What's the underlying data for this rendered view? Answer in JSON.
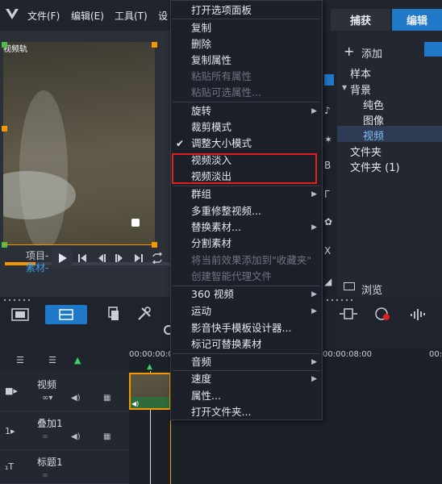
{
  "menubar": {
    "items": [
      "文件(F)",
      "编辑(E)",
      "工具(T)",
      "设"
    ],
    "tabs": [
      "捕获",
      "编辑"
    ]
  },
  "preview": {
    "label": "视频轨",
    "project_label": "项目-",
    "clip_label": "素材-"
  },
  "library": {
    "add_label": "添加",
    "tree": [
      "样本",
      "背景",
      "纯色",
      "图像",
      "视频",
      "文件夹",
      "文件夹 (1)"
    ],
    "browse_label": "浏览"
  },
  "timeline": {
    "ruler": [
      "00:00:00:00",
      "00:00:08:00",
      "00:"
    ],
    "tracks": [
      {
        "name": "视频"
      },
      {
        "name": "叠加1"
      },
      {
        "name": "标题1"
      }
    ]
  },
  "context_menu": {
    "items": [
      {
        "label": "打开选项面板",
        "disabled": false
      },
      {
        "label": "复制",
        "disabled": false
      },
      {
        "label": "删除",
        "disabled": false
      },
      {
        "label": "复制属性",
        "disabled": false
      },
      {
        "label": "粘贴所有属性",
        "disabled": true
      },
      {
        "label": "粘贴可选属性...",
        "disabled": true
      },
      {
        "label": "旋转",
        "disabled": false
      },
      {
        "label": "裁剪模式",
        "disabled": false
      },
      {
        "label": "调整大小模式",
        "disabled": false,
        "checked": true
      },
      {
        "label": "视频淡入",
        "disabled": false
      },
      {
        "label": "视频淡出",
        "disabled": false
      },
      {
        "label": "群组",
        "disabled": false
      },
      {
        "label": "多重修整视频...",
        "disabled": false
      },
      {
        "label": "替换素材...",
        "disabled": false
      },
      {
        "label": "分割素材",
        "disabled": false
      },
      {
        "label": "将当前效果添加到\"收藏夹\"",
        "disabled": true
      },
      {
        "label": "创建智能代理文件",
        "disabled": true
      },
      {
        "label": "360 视频",
        "disabled": false
      },
      {
        "label": "运动",
        "disabled": false
      },
      {
        "label": "影音快手模板设计器...",
        "disabled": false
      },
      {
        "label": "标记可替换素材",
        "disabled": false
      },
      {
        "label": "音频",
        "disabled": false
      },
      {
        "label": "速度",
        "disabled": false
      },
      {
        "label": "属性...",
        "disabled": false
      },
      {
        "label": "打开文件夹...",
        "disabled": false
      }
    ]
  },
  "colors": {
    "accent": "#f39800",
    "tab_active": "#1f78c8",
    "highlight_box": "#e02020"
  }
}
